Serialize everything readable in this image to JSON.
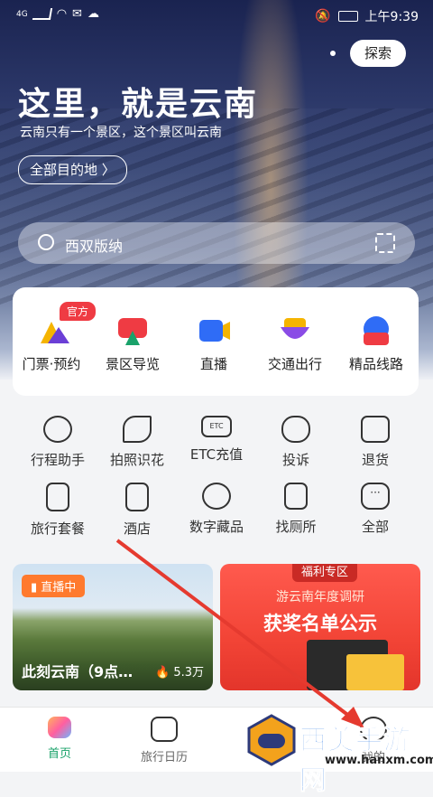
{
  "status_bar": {
    "signal": "4G",
    "time": "上午9:39"
  },
  "header": {
    "search_button": "探索",
    "title": "这里，就是云南",
    "subtitle": "云南只有一个景区，这个景区叫云南",
    "all_destinations_button": "全部目的地 〉"
  },
  "search": {
    "value": "西双版纳"
  },
  "quick_actions": [
    {
      "label": "门票·预约",
      "badge": "官方"
    },
    {
      "label": "景区导览"
    },
    {
      "label": "直播"
    },
    {
      "label": "交通出行"
    },
    {
      "label": "精品线路"
    }
  ],
  "services": [
    {
      "label": "行程助手"
    },
    {
      "label": "拍照识花"
    },
    {
      "label": "ETC充值"
    },
    {
      "label": "投诉"
    },
    {
      "label": "退货"
    },
    {
      "label": "旅行套餐"
    },
    {
      "label": "酒店"
    },
    {
      "label": "数字藏品"
    },
    {
      "label": "找厕所"
    },
    {
      "label": "全部"
    }
  ],
  "live_card": {
    "tag": "直播中",
    "title": "此刻云南（9点…",
    "views": "5.3万"
  },
  "promo_card": {
    "tag": "福利专区",
    "line1": "游云南年度调研",
    "line2": "获奖名单公示"
  },
  "tabbar": [
    {
      "label": "首页"
    },
    {
      "label": "旅行日历"
    },
    {
      "label": ""
    },
    {
      "label": ""
    },
    {
      "label": "我的"
    }
  ],
  "watermark": {
    "text": "西美手游网",
    "url": "www.hanxm.com"
  },
  "colors": {
    "accent": "#1aa26a",
    "badge": "#ef3b43",
    "live": "#ff7a2e",
    "promo": "#f24436"
  }
}
